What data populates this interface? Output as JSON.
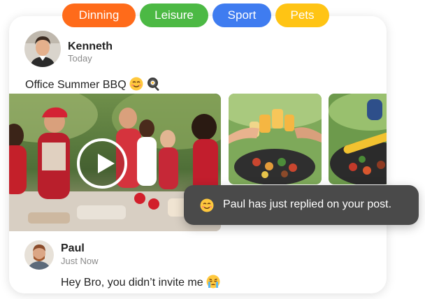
{
  "tags": [
    {
      "label": "Dinning",
      "color": "#ff6b1a"
    },
    {
      "label": "Leisure",
      "color": "#4cb944"
    },
    {
      "label": "Sport",
      "color": "#3f7cf0"
    },
    {
      "label": "Pets",
      "color": "#ffc414"
    }
  ],
  "post": {
    "author": "Kenneth",
    "time": "Today",
    "text": "Office Summer BBQ",
    "emojis": [
      "smiling-face-icon",
      "frying-pan-icon"
    ]
  },
  "media": {
    "video_thumbnail": "bbq-party-photo",
    "photos": [
      "drinks-toast-photo",
      "grilled-corn-photo"
    ],
    "play_icon": "play-icon"
  },
  "comment": {
    "author": "Paul",
    "time": "Just Now",
    "text": "Hey Bro, you didn’t invite me",
    "emoji": "crying-face-icon"
  },
  "toast": {
    "emoji": "smiling-face-icon",
    "message": "Paul has just replied on your post."
  }
}
